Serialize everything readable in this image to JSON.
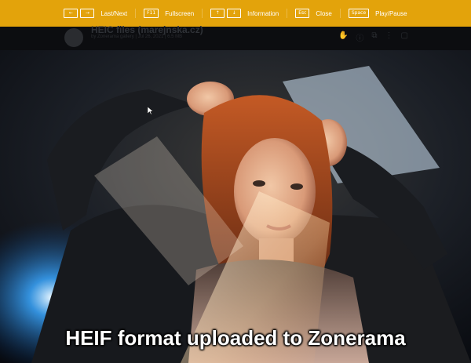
{
  "hint_bar": {
    "hints": [
      {
        "keys": [
          "←",
          "→"
        ],
        "label": "Last/Next"
      },
      {
        "keys": [
          "F11"
        ],
        "label": "Fullscreen"
      },
      {
        "keys": [
          "↑",
          "↓"
        ],
        "label": "Information"
      },
      {
        "keys": [
          "Esc"
        ],
        "label": "Close"
      },
      {
        "keys": [
          "Space"
        ],
        "label": "Play/Pause"
      }
    ],
    "background": "#e3a30b"
  },
  "album_header": {
    "title": "HEIC files (marejnska.cz)",
    "meta": "by Zonerama gallery | Jul 26, 2021 | 6.5 MB"
  },
  "photo": {
    "caption": "HEIF format uploaded to Zonerama"
  }
}
